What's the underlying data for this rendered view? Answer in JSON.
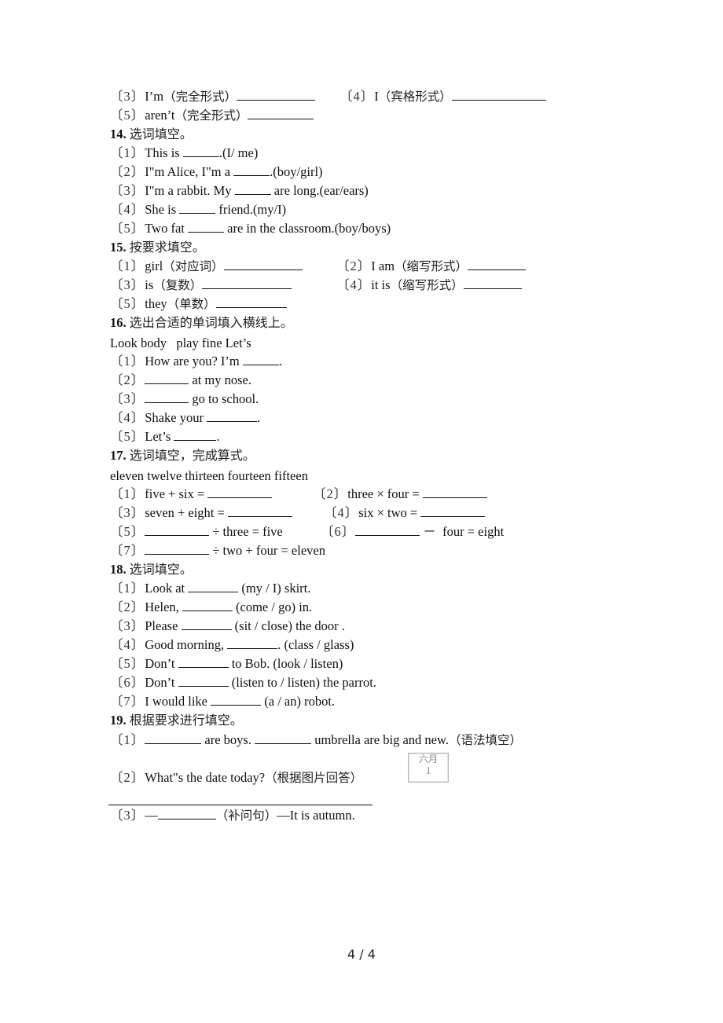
{
  "q13": {
    "items": [
      {
        "idx": "〔3〕",
        "text": "I’m",
        "hint": "（完全形式）"
      },
      {
        "idx": "〔4〕",
        "text": "I",
        "hint": "（宾格形式）"
      },
      {
        "idx": "〔5〕",
        "text": "aren’t",
        "hint": "（完全形式）"
      }
    ]
  },
  "q14": {
    "number": "14.",
    "title": "选词填空。",
    "items": [
      {
        "idx": "〔1〕",
        "before": "This is ",
        "after": ".(I/ me)"
      },
      {
        "idx": "〔2〕",
        "before": "I\"m Alice, I\"m a ",
        "after": ".(boy/girl)"
      },
      {
        "idx": "〔3〕",
        "before": "I\"m a rabbit. My ",
        "after": " are long.(ear/ears)"
      },
      {
        "idx": "〔4〕",
        "before": "She is ",
        "after": " friend.(my/I)"
      },
      {
        "idx": "〔5〕",
        "before": "Two fat ",
        "after": " are in the classroom.(boy/boys)"
      }
    ]
  },
  "q15": {
    "number": "15.",
    "title": "按要求填空。",
    "items": [
      {
        "idx": "〔1〕",
        "text": "girl",
        "hint": "（对应词）"
      },
      {
        "idx": "〔2〕",
        "text": "I am",
        "hint": "（缩写形式）"
      },
      {
        "idx": "〔3〕",
        "text": "is",
        "hint": "（复数）"
      },
      {
        "idx": "〔4〕",
        "text": "it is",
        "hint": "（缩写形式）"
      },
      {
        "idx": "〔5〕",
        "text": "they",
        "hint": "（单数）"
      }
    ]
  },
  "q16": {
    "number": "16.",
    "title": "选出合适的单词填入横线上。",
    "word_bank": "Look body   play fine Let’s",
    "items": [
      {
        "idx": "〔1〕",
        "before": "How are you? I’m ",
        "after": "."
      },
      {
        "idx": "〔2〕",
        "before": "",
        "after": " at my nose."
      },
      {
        "idx": "〔3〕",
        "before": "",
        "after": " go to school."
      },
      {
        "idx": "〔4〕",
        "before": "Shake your ",
        "after": "."
      },
      {
        "idx": "〔5〕",
        "before": "Let’s ",
        "after": "."
      }
    ]
  },
  "q17": {
    "number": "17.",
    "title": "选词填空，完成算式。",
    "word_bank": "eleven twelve thirteen fourteen fifteen",
    "items": [
      {
        "idx": "〔1〕",
        "before": "five + six = ",
        "after": ""
      },
      {
        "idx": "〔2〕",
        "before": "three × four = ",
        "after": ""
      },
      {
        "idx": "〔3〕",
        "before": "seven + eight = ",
        "after": ""
      },
      {
        "idx": "〔4〕",
        "before": "six × two = ",
        "after": ""
      },
      {
        "idx": "〔5〕",
        "before": "",
        "after": " ÷ three = five"
      },
      {
        "idx": "〔6〕",
        "before": "",
        "after": " －  four = eight"
      },
      {
        "idx": "〔7〕",
        "before": "",
        "after": " ÷ two + four = eleven"
      }
    ]
  },
  "q18": {
    "number": "18.",
    "title": "选词填空。",
    "items": [
      {
        "idx": "〔1〕",
        "before": "Look at ",
        "after": " (my / I) skirt."
      },
      {
        "idx": "〔2〕",
        "before": "Helen, ",
        "after": " (come / go) in."
      },
      {
        "idx": "〔3〕",
        "before": "Please ",
        "after": " (sit / close) the door ."
      },
      {
        "idx": "〔4〕",
        "before": "Good morning, ",
        "after": ". (class / glass)"
      },
      {
        "idx": "〔5〕",
        "before": "Don’t ",
        "after": " to Bob. (look / listen)"
      },
      {
        "idx": "〔6〕",
        "before": "Don’t ",
        "after": " (listen to / listen) the parrot."
      },
      {
        "idx": "〔7〕",
        "before": "I would like ",
        "after": " (a / an) robot."
      }
    ]
  },
  "q19": {
    "number": "19.",
    "title": "根据要求进行填空。",
    "items": [
      {
        "idx": "〔1〕",
        "mid": " are boys. ",
        "after": " umbrella are big and new.",
        "hint": "（语法填空）"
      },
      {
        "idx": "〔2〕",
        "text": "What\"s the date today?",
        "hint": "（根据图片回答）"
      },
      {
        "idx": "〔3〕",
        "before": "—",
        "hint": "（补问句）",
        "after": "—It is autumn."
      }
    ],
    "calendar": {
      "month": "六月",
      "day": "1"
    }
  },
  "footer": {
    "page": "4 / 4"
  }
}
